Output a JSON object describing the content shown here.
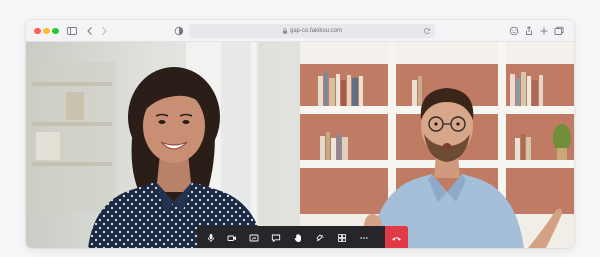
{
  "browser": {
    "url": "gap-co.fakikou.com",
    "traffic_lights": {
      "close": "#ff5f57",
      "minimize": "#febc2e",
      "zoom": "#28c840"
    },
    "toolbar_icons": [
      "sidebar-icon",
      "back-icon",
      "forward-icon",
      "privacy-shield-icon",
      "lock-icon",
      "reload-icon",
      "extension-icon",
      "share-icon",
      "new-tab-icon",
      "tabs-overview-icon"
    ]
  },
  "call": {
    "participants": [
      "woman-with-polka-dot-shirt",
      "man-with-glasses-gesturing"
    ],
    "controls": [
      "microphone-icon",
      "camera-icon",
      "screen-share-icon",
      "chat-icon",
      "raise-hand-icon",
      "reactions-icon",
      "layout-grid-icon",
      "more-icon",
      "end-call-icon"
    ],
    "colors": {
      "control_bar": "#26262a",
      "end_call": "#e03a46"
    }
  }
}
